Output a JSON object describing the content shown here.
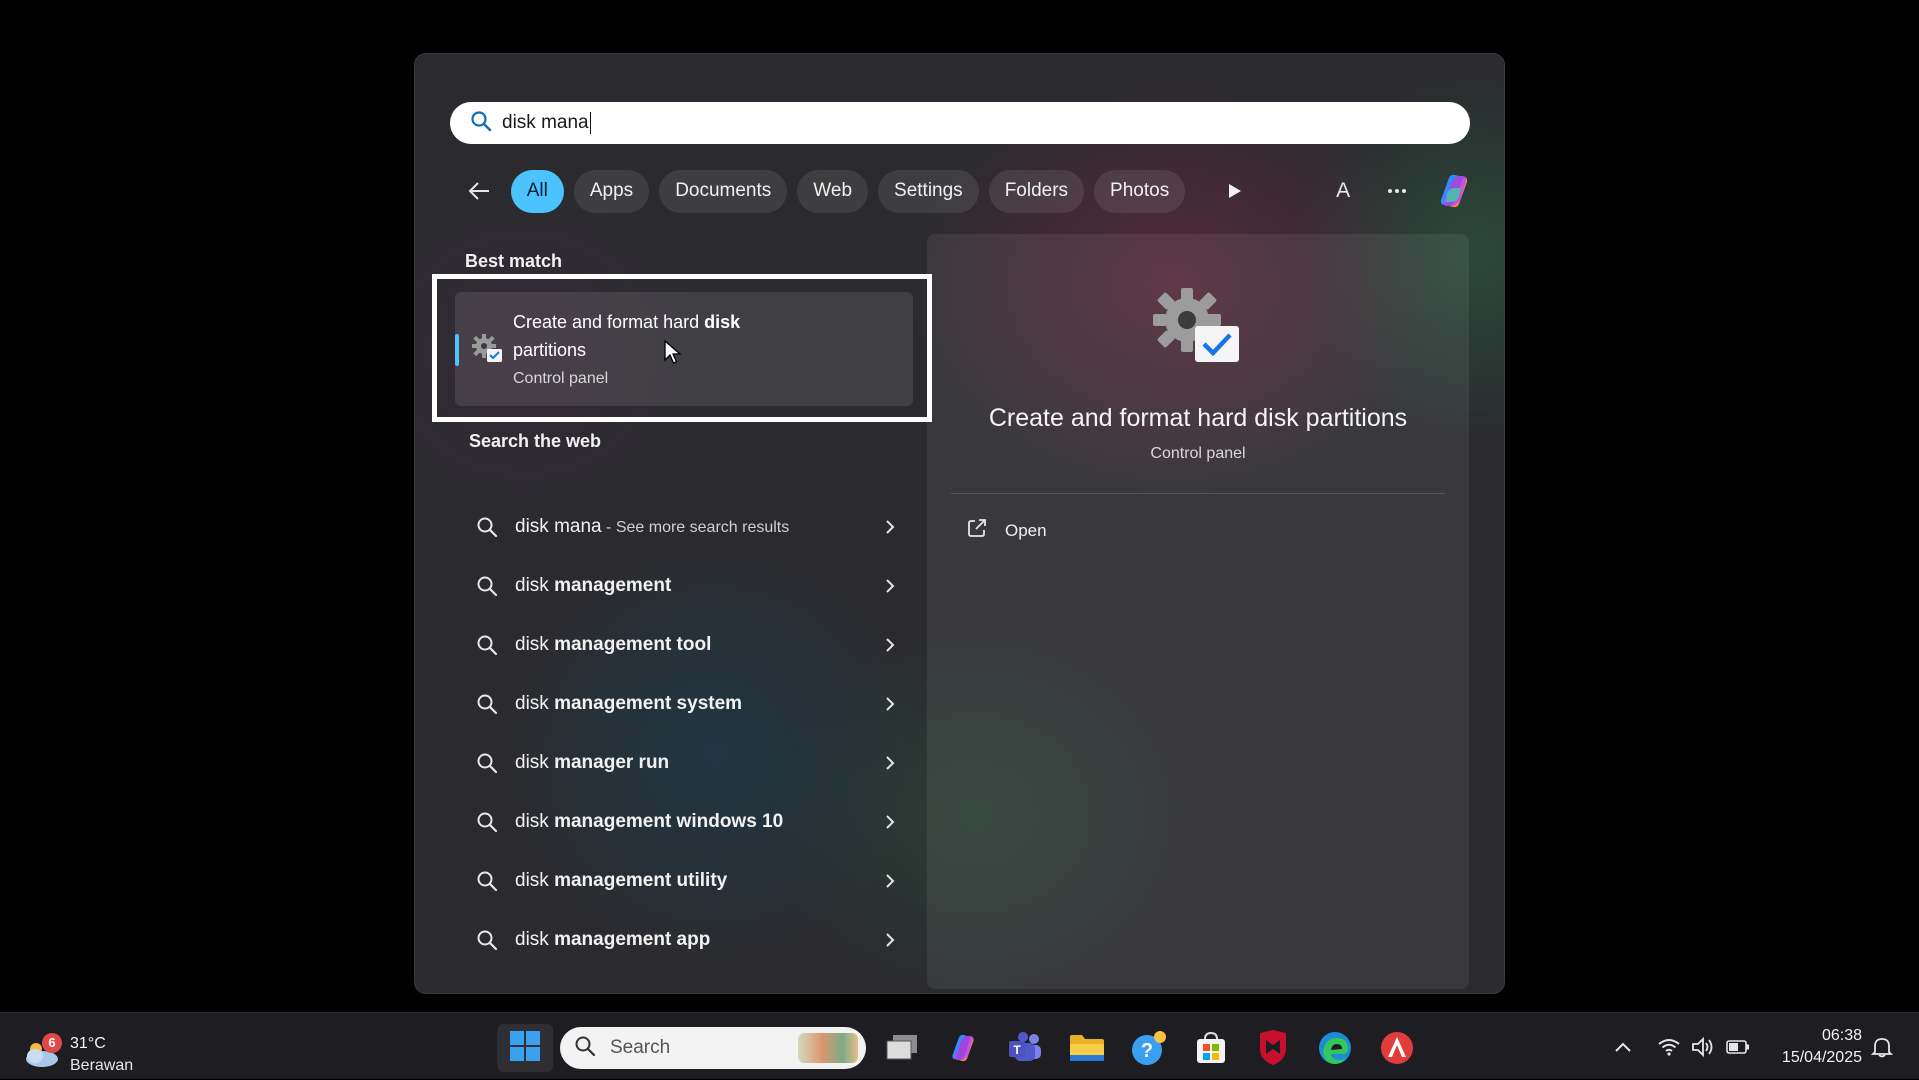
{
  "search": {
    "query": "disk mana"
  },
  "filters": {
    "chips": [
      "All",
      "Apps",
      "Documents",
      "Web",
      "Settings",
      "Folders",
      "Photos"
    ],
    "active": "All",
    "avatar_letter": "A"
  },
  "best_match": {
    "heading": "Best match",
    "title_prefix": "Create and format hard ",
    "title_bold": "disk",
    "title_suffix": "partitions",
    "subtitle": "Control panel"
  },
  "web": {
    "heading": "Search the web",
    "first": {
      "query": "disk mana",
      "hint": " - See more search results"
    },
    "items": [
      {
        "prefix": "disk ",
        "bold": "management"
      },
      {
        "prefix": "disk ",
        "bold": "management tool"
      },
      {
        "prefix": "disk ",
        "bold": "management system"
      },
      {
        "prefix": "disk ",
        "bold": "manager run"
      },
      {
        "prefix": "disk ",
        "bold": "management windows 10"
      },
      {
        "prefix": "disk ",
        "bold": "management utility"
      },
      {
        "prefix": "disk ",
        "bold": "management app"
      }
    ]
  },
  "preview": {
    "title": "Create and format hard disk partitions",
    "subtitle": "Control panel",
    "action_open": "Open"
  },
  "taskbar": {
    "weather_badge": "6",
    "weather_temp": "31°C",
    "weather_condition": "Berawan",
    "search_label": "Search",
    "time": "06:38",
    "date": "15/04/2025"
  },
  "colors": {
    "accent": "#4cc2ff",
    "panel_bg": "#2b2b2f",
    "taskbar_bg": "#1e1e22"
  }
}
